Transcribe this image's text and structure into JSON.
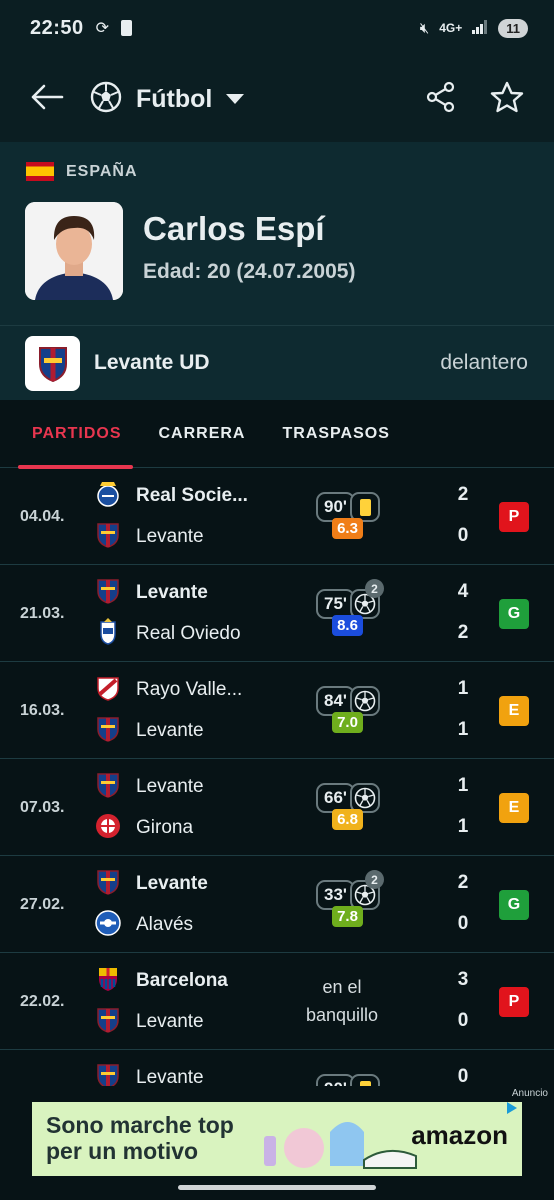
{
  "statusbar": {
    "time": "22:50",
    "network": "4G+",
    "battery": "11"
  },
  "appbar": {
    "title": "Fútbol"
  },
  "profile": {
    "country": "ESPAÑA",
    "name": "Carlos Espí",
    "age_label": "Edad: 20 (24.07.2005)",
    "team": "Levante UD",
    "position": "delantero"
  },
  "tabs": [
    {
      "label": "PARTIDOS",
      "active": true
    },
    {
      "label": "CARRERA",
      "active": false
    },
    {
      "label": "TRASPASOS",
      "active": false
    }
  ],
  "matches": [
    {
      "date": "04.04.",
      "home": "Real Socie...",
      "away": "Levante",
      "home_bold": true,
      "away_bold": false,
      "home_score": "2",
      "away_score": "0",
      "minutes": "90'",
      "event": "yellow-card",
      "rating": "6.3",
      "rating_color": "#f07e18",
      "result": "P",
      "result_color": "#e1141c",
      "home_crest": "real-sociedad",
      "away_crest": "levante"
    },
    {
      "date": "21.03.",
      "home": "Levante",
      "away": "Real Oviedo",
      "home_bold": true,
      "away_bold": false,
      "home_score": "4",
      "away_score": "2",
      "minutes": "75'",
      "event": "goal",
      "event_count": "2",
      "rating": "8.6",
      "rating_color": "#1b4ddd",
      "result": "G",
      "result_color": "#1f9f3b",
      "home_crest": "levante",
      "away_crest": "real-oviedo"
    },
    {
      "date": "16.03.",
      "home": "Rayo Valle...",
      "away": "Levante",
      "home_bold": false,
      "away_bold": false,
      "home_score": "1",
      "away_score": "1",
      "minutes": "84'",
      "event": "goal",
      "rating": "7.0",
      "rating_color": "#6fae1d",
      "result": "E",
      "result_color": "#f1a20f",
      "home_crest": "rayo",
      "away_crest": "levante"
    },
    {
      "date": "07.03.",
      "home": "Levante",
      "away": "Girona",
      "home_bold": false,
      "away_bold": false,
      "home_score": "1",
      "away_score": "1",
      "minutes": "66'",
      "event": "goal",
      "rating": "6.8",
      "rating_color": "#f0b21c",
      "result": "E",
      "result_color": "#f1a20f",
      "home_crest": "levante",
      "away_crest": "girona"
    },
    {
      "date": "27.02.",
      "home": "Levante",
      "away": "Alavés",
      "home_bold": true,
      "away_bold": false,
      "home_score": "2",
      "away_score": "0",
      "minutes": "33'",
      "event": "goal",
      "event_count": "2",
      "rating": "7.8",
      "rating_color": "#6fae1d",
      "result": "G",
      "result_color": "#1f9f3b",
      "home_crest": "levante",
      "away_crest": "alaves"
    },
    {
      "date": "22.02.",
      "home": "Barcelona",
      "away": "Levante",
      "home_bold": true,
      "away_bold": false,
      "home_score": "3",
      "away_score": "0",
      "bench_text": "en el banquillo",
      "result": "P",
      "result_color": "#e1141c",
      "home_crest": "barcelona",
      "away_crest": "levante"
    },
    {
      "date": "",
      "home": "Levante",
      "away": "",
      "home_bold": false,
      "away_bold": false,
      "home_score": "0",
      "away_score": "",
      "minutes": "90'",
      "event": "yellow-card",
      "result": "",
      "result_color": "#e1141c",
      "home_crest": "levante",
      "away_crest": ""
    }
  ],
  "ad": {
    "label": "Anuncio",
    "text_line1": "Sono marche top",
    "text_line2": "per un motivo",
    "brand": "amazon"
  }
}
